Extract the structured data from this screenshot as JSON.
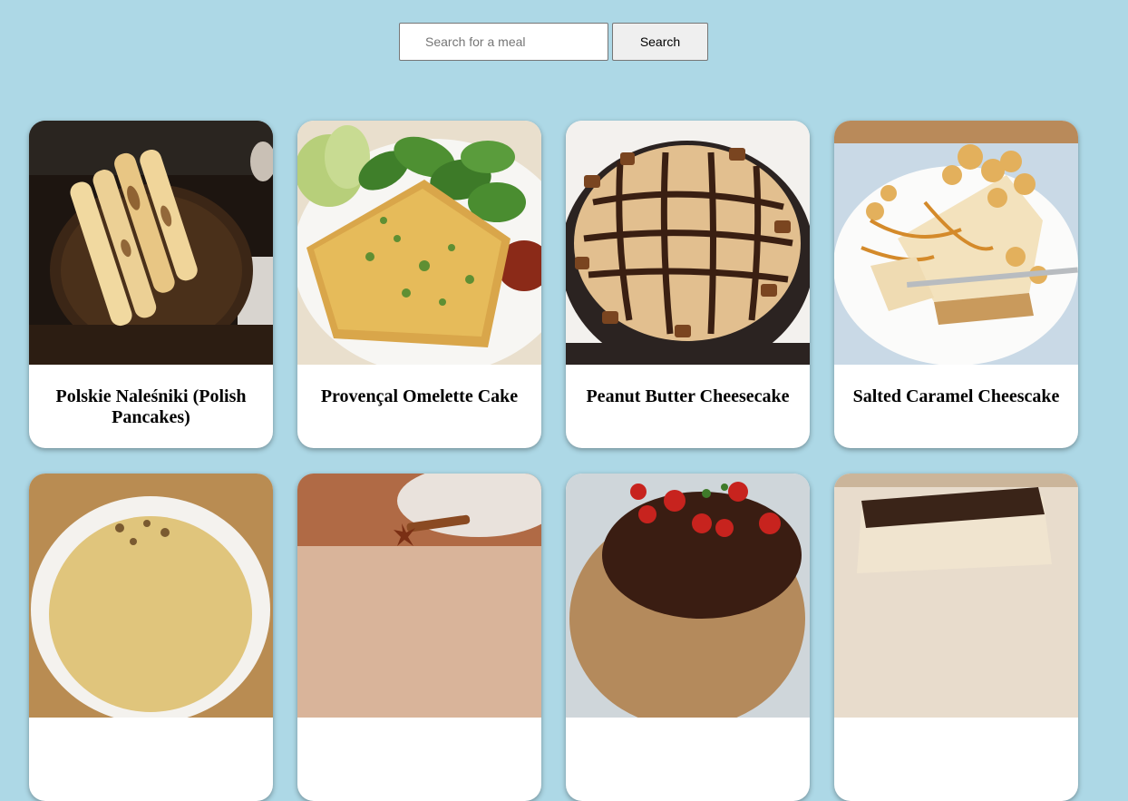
{
  "search": {
    "placeholder": "Search for a meal",
    "value": "",
    "button_label": "Search"
  },
  "meals": [
    {
      "title": "Polskie Naleśniki (Polish Pancakes)",
      "image": "polish-pancakes-image"
    },
    {
      "title": "Provençal Omelette Cake",
      "image": "omelette-cake-image"
    },
    {
      "title": "Peanut Butter Cheesecake",
      "image": "peanut-butter-cheesecake-image"
    },
    {
      "title": "Salted Caramel Cheescake",
      "image": "salted-caramel-cheesecake-image"
    },
    {
      "title": "",
      "image": "pie-image"
    },
    {
      "title": "",
      "image": "cinnamon-dessert-image"
    },
    {
      "title": "",
      "image": "strawberry-tart-image"
    },
    {
      "title": "",
      "image": "chocolate-cheesecake-image"
    }
  ],
  "colors": {
    "background": "#add8e6",
    "card": "#ffffff"
  }
}
